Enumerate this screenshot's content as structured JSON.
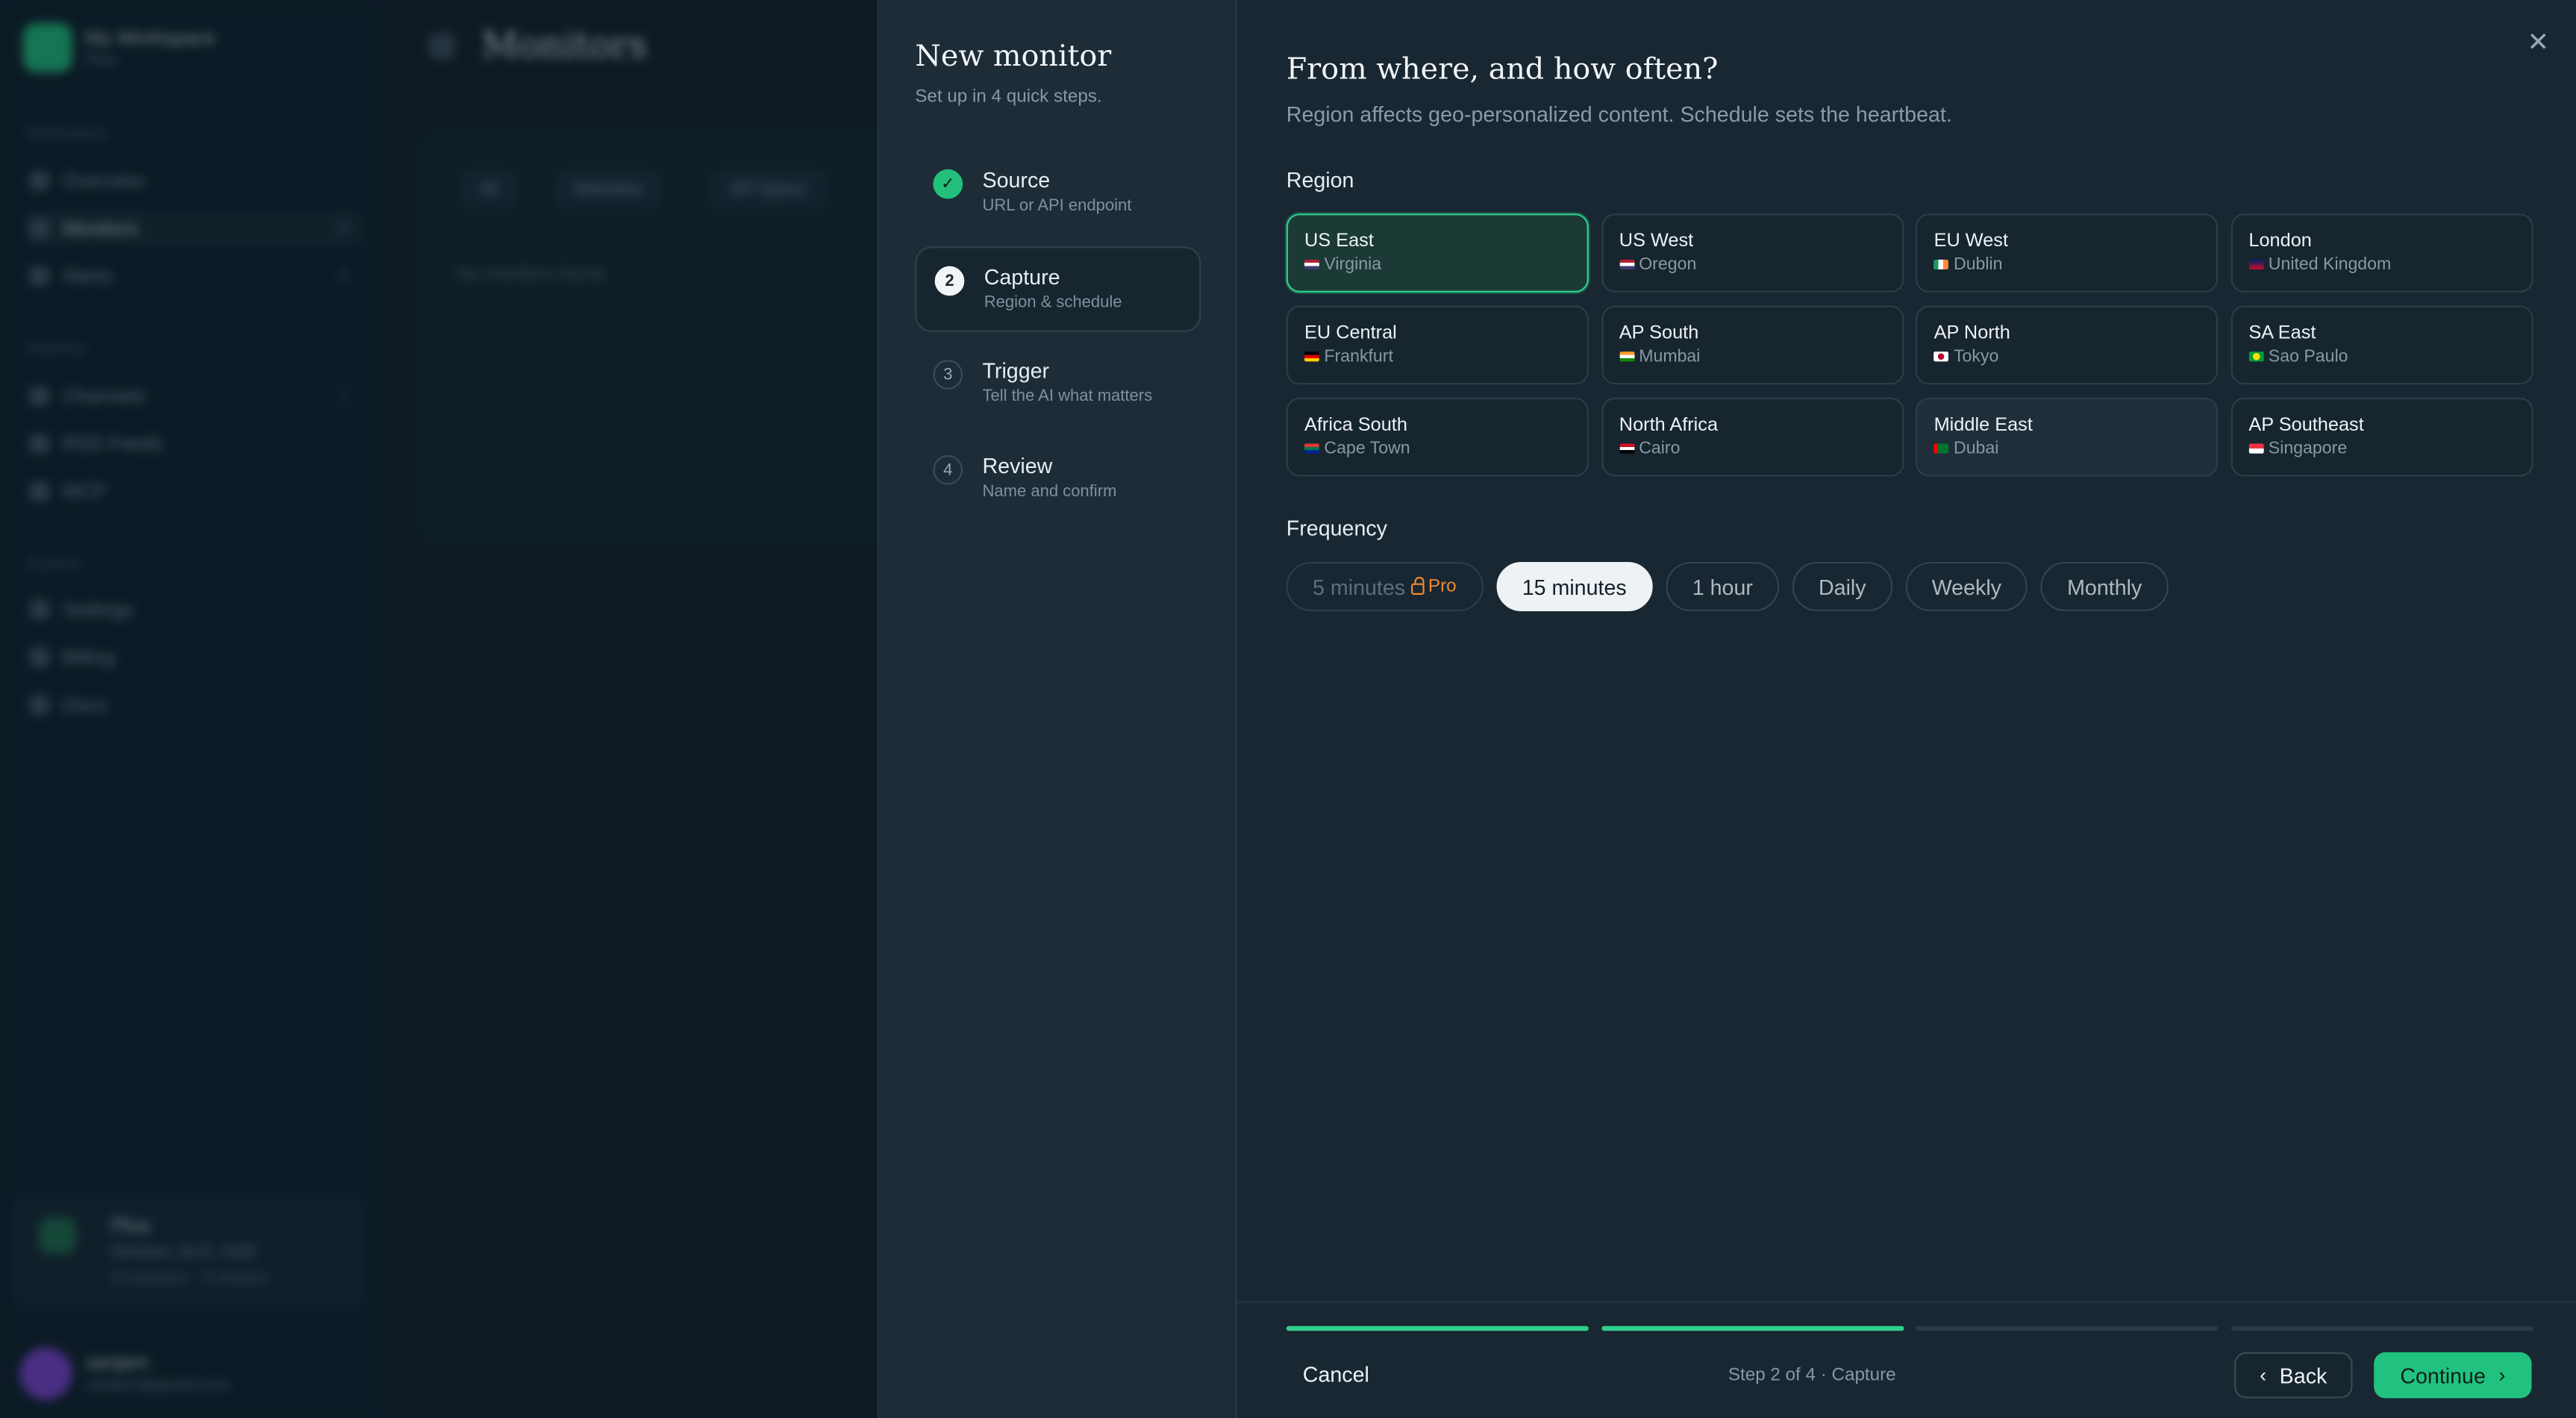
{
  "background": {
    "workspace_name": "My Workspace",
    "workspace_plan": "Plus",
    "sidebar_sections": [
      "Workspace",
      "Delivery",
      "System"
    ],
    "sidebar_items": [
      {
        "label": "Overview",
        "count": ""
      },
      {
        "label": "Monitors",
        "count": "0"
      },
      {
        "label": "Alerts",
        "count": "0"
      },
      {
        "label": "Channels",
        "count": "1"
      },
      {
        "label": "RSS Feeds",
        "count": ""
      },
      {
        "label": "MCP",
        "count": ""
      },
      {
        "label": "Settings",
        "count": ""
      },
      {
        "label": "Billing",
        "count": ""
      },
      {
        "label": "Docs",
        "count": ""
      }
    ],
    "plan_card": {
      "title": "Plus",
      "line1": "Renews Jul 8, 1926",
      "line2": "0 monitors · 0 checks"
    },
    "user": {
      "name": "sanjam",
      "email": "sanjam@gmail.com"
    },
    "page_title": "Monitors",
    "filters": [
      "All",
      "Websites",
      "API Specs"
    ],
    "empty_text": "No monitors found"
  },
  "modal": {
    "title": "New monitor",
    "subtitle": "Set up in 4 quick steps.",
    "steps": [
      {
        "num": "✓",
        "label": "Source",
        "sub": "URL or API endpoint",
        "state": "done"
      },
      {
        "num": "2",
        "label": "Capture",
        "sub": "Region & schedule",
        "state": "current"
      },
      {
        "num": "3",
        "label": "Trigger",
        "sub": "Tell the AI what matters",
        "state": "upcoming"
      },
      {
        "num": "4",
        "label": "Review",
        "sub": "Name and confirm",
        "state": "upcoming"
      }
    ],
    "heading": "From where, and how often?",
    "description": "Region affects geo-personalized content. Schedule sets the heartbeat.",
    "region_label": "Region",
    "regions": [
      {
        "name": "US East",
        "city": "Virginia",
        "flag": "us",
        "selected": true
      },
      {
        "name": "US West",
        "city": "Oregon",
        "flag": "us",
        "selected": false
      },
      {
        "name": "EU West",
        "city": "Dublin",
        "flag": "ie",
        "selected": false
      },
      {
        "name": "London",
        "city": "United Kingdom",
        "flag": "gb",
        "selected": false
      },
      {
        "name": "EU Central",
        "city": "Frankfurt",
        "flag": "de",
        "selected": false
      },
      {
        "name": "AP South",
        "city": "Mumbai",
        "flag": "in",
        "selected": false
      },
      {
        "name": "AP North",
        "city": "Tokyo",
        "flag": "jp",
        "selected": false
      },
      {
        "name": "SA East",
        "city": "Sao Paulo",
        "flag": "br",
        "selected": false
      },
      {
        "name": "Africa South",
        "city": "Cape Town",
        "flag": "za",
        "selected": false
      },
      {
        "name": "North Africa",
        "city": "Cairo",
        "flag": "eg",
        "selected": false
      },
      {
        "name": "Middle East",
        "city": "Dubai",
        "flag": "ae",
        "selected": false
      },
      {
        "name": "AP Southeast",
        "city": "Singapore",
        "flag": "sg",
        "selected": false
      }
    ],
    "frequency_label": "Frequency",
    "frequencies": [
      {
        "label": "5 minutes",
        "badge": "Pro",
        "state": "disabled"
      },
      {
        "label": "15 minutes",
        "badge": "",
        "state": "selected"
      },
      {
        "label": "1 hour",
        "badge": "",
        "state": "normal"
      },
      {
        "label": "Daily",
        "badge": "",
        "state": "normal"
      },
      {
        "label": "Weekly",
        "badge": "",
        "state": "normal"
      },
      {
        "label": "Monthly",
        "badge": "",
        "state": "normal"
      }
    ],
    "progress": {
      "completed": 2,
      "total": 4
    },
    "footer": {
      "cancel": "Cancel",
      "step_info": "Step 2 of 4 · Capture",
      "back": "Back",
      "continue": "Continue"
    },
    "colors": {
      "accent": "#2fcf8c",
      "pro": "#ef8a2d",
      "modal_bg": "#182731"
    }
  }
}
